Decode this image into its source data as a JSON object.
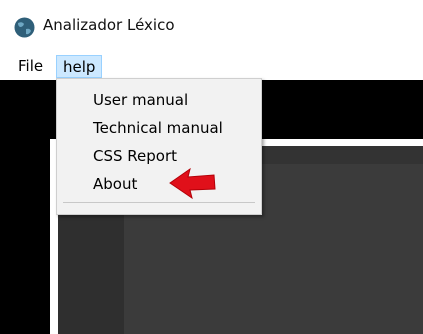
{
  "window": {
    "title": "Analizador Léxico",
    "icon": "globe-icon"
  },
  "menubar": {
    "file_label": "File",
    "help_label": "help"
  },
  "help_menu": {
    "items": [
      {
        "label": "User manual"
      },
      {
        "label": "Technical manual"
      },
      {
        "label": "CSS Report"
      },
      {
        "label": "About"
      }
    ]
  },
  "colors": {
    "menu_highlight": "#cce8ff",
    "annotation_arrow": "#e0101a",
    "workspace_bg": "#000000",
    "panel_bg": "#3b3b3b"
  }
}
